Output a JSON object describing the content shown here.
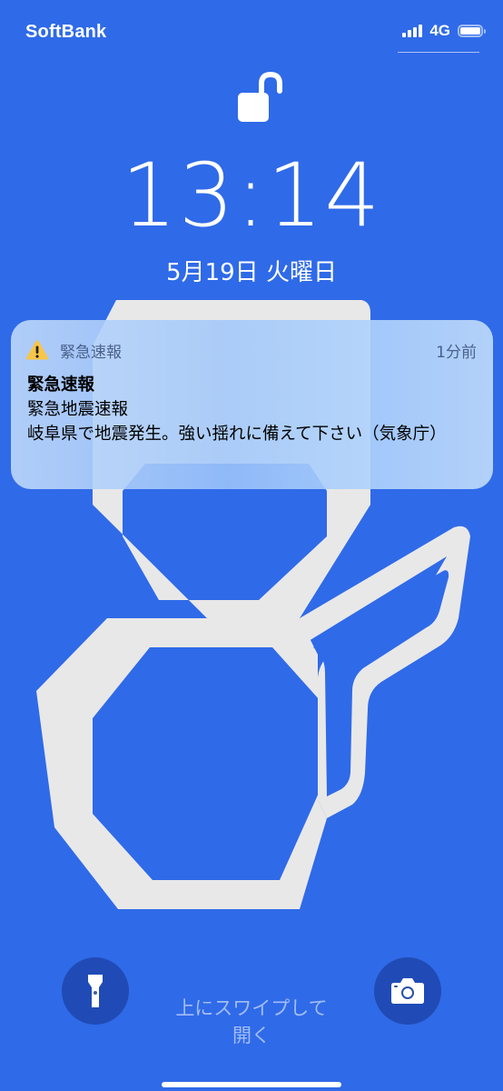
{
  "status_bar": {
    "carrier": "SoftBank",
    "network": "4G",
    "signal_icon": "signal-bars-icon",
    "battery_icon": "battery-icon"
  },
  "lock": {
    "icon": "unlocked-padlock-icon"
  },
  "clock": {
    "time": "13:14",
    "date": "5月19日 火曜日"
  },
  "notification": {
    "app_name": "緊急速報",
    "time_ago": "1分前",
    "title": "緊急速報",
    "line1": "緊急地震速報",
    "line2": "岐阜県で地震発生。強い揺れに備えて下さい（気象庁）",
    "icon": "warning-icon"
  },
  "bottom": {
    "flashlight_icon": "flashlight-icon",
    "camera_icon": "camera-icon",
    "swipe_hint_line1": "上にスワイプして",
    "swipe_hint_line2": "開く"
  },
  "colors": {
    "background": "#2f6ae8",
    "wallpaper_shape": "#e8e8e8"
  }
}
